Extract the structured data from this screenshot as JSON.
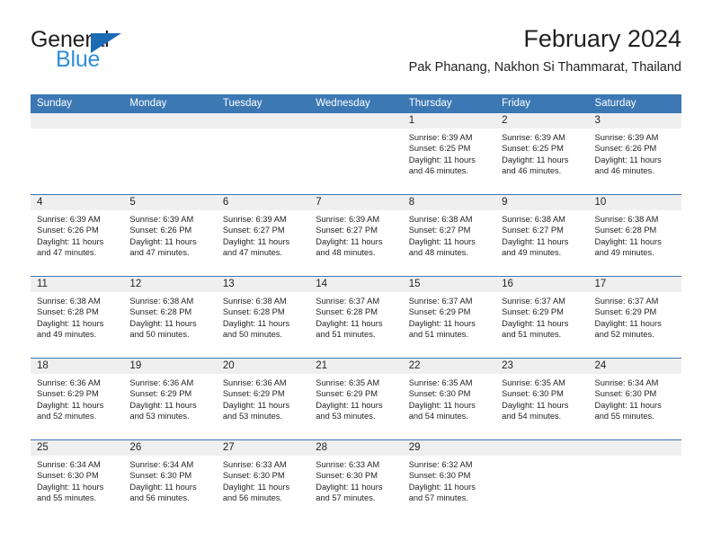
{
  "brand": {
    "name_top": "General",
    "name_bottom": "Blue",
    "accent_color": "#2f8fd6",
    "triangle_color": "#1b6cb5"
  },
  "header": {
    "title": "February 2024",
    "subtitle": "Pak Phanang, Nakhon Si Thammarat, Thailand"
  },
  "calendar": {
    "header_bg": "#3c78b4",
    "header_text_color": "#ffffff",
    "day_band_bg": "#efefef",
    "weekdays": [
      "Sunday",
      "Monday",
      "Tuesday",
      "Wednesday",
      "Thursday",
      "Friday",
      "Saturday"
    ],
    "weeks": [
      [
        {
          "day": "",
          "sunrise": "",
          "sunset": "",
          "daylight": ""
        },
        {
          "day": "",
          "sunrise": "",
          "sunset": "",
          "daylight": ""
        },
        {
          "day": "",
          "sunrise": "",
          "sunset": "",
          "daylight": ""
        },
        {
          "day": "",
          "sunrise": "",
          "sunset": "",
          "daylight": ""
        },
        {
          "day": "1",
          "sunrise": "Sunrise: 6:39 AM",
          "sunset": "Sunset: 6:25 PM",
          "daylight": "Daylight: 11 hours and 46 minutes."
        },
        {
          "day": "2",
          "sunrise": "Sunrise: 6:39 AM",
          "sunset": "Sunset: 6:25 PM",
          "daylight": "Daylight: 11 hours and 46 minutes."
        },
        {
          "day": "3",
          "sunrise": "Sunrise: 6:39 AM",
          "sunset": "Sunset: 6:26 PM",
          "daylight": "Daylight: 11 hours and 46 minutes."
        }
      ],
      [
        {
          "day": "4",
          "sunrise": "Sunrise: 6:39 AM",
          "sunset": "Sunset: 6:26 PM",
          "daylight": "Daylight: 11 hours and 47 minutes."
        },
        {
          "day": "5",
          "sunrise": "Sunrise: 6:39 AM",
          "sunset": "Sunset: 6:26 PM",
          "daylight": "Daylight: 11 hours and 47 minutes."
        },
        {
          "day": "6",
          "sunrise": "Sunrise: 6:39 AM",
          "sunset": "Sunset: 6:27 PM",
          "daylight": "Daylight: 11 hours and 47 minutes."
        },
        {
          "day": "7",
          "sunrise": "Sunrise: 6:39 AM",
          "sunset": "Sunset: 6:27 PM",
          "daylight": "Daylight: 11 hours and 48 minutes."
        },
        {
          "day": "8",
          "sunrise": "Sunrise: 6:38 AM",
          "sunset": "Sunset: 6:27 PM",
          "daylight": "Daylight: 11 hours and 48 minutes."
        },
        {
          "day": "9",
          "sunrise": "Sunrise: 6:38 AM",
          "sunset": "Sunset: 6:27 PM",
          "daylight": "Daylight: 11 hours and 49 minutes."
        },
        {
          "day": "10",
          "sunrise": "Sunrise: 6:38 AM",
          "sunset": "Sunset: 6:28 PM",
          "daylight": "Daylight: 11 hours and 49 minutes."
        }
      ],
      [
        {
          "day": "11",
          "sunrise": "Sunrise: 6:38 AM",
          "sunset": "Sunset: 6:28 PM",
          "daylight": "Daylight: 11 hours and 49 minutes."
        },
        {
          "day": "12",
          "sunrise": "Sunrise: 6:38 AM",
          "sunset": "Sunset: 6:28 PM",
          "daylight": "Daylight: 11 hours and 50 minutes."
        },
        {
          "day": "13",
          "sunrise": "Sunrise: 6:38 AM",
          "sunset": "Sunset: 6:28 PM",
          "daylight": "Daylight: 11 hours and 50 minutes."
        },
        {
          "day": "14",
          "sunrise": "Sunrise: 6:37 AM",
          "sunset": "Sunset: 6:28 PM",
          "daylight": "Daylight: 11 hours and 51 minutes."
        },
        {
          "day": "15",
          "sunrise": "Sunrise: 6:37 AM",
          "sunset": "Sunset: 6:29 PM",
          "daylight": "Daylight: 11 hours and 51 minutes."
        },
        {
          "day": "16",
          "sunrise": "Sunrise: 6:37 AM",
          "sunset": "Sunset: 6:29 PM",
          "daylight": "Daylight: 11 hours and 51 minutes."
        },
        {
          "day": "17",
          "sunrise": "Sunrise: 6:37 AM",
          "sunset": "Sunset: 6:29 PM",
          "daylight": "Daylight: 11 hours and 52 minutes."
        }
      ],
      [
        {
          "day": "18",
          "sunrise": "Sunrise: 6:36 AM",
          "sunset": "Sunset: 6:29 PM",
          "daylight": "Daylight: 11 hours and 52 minutes."
        },
        {
          "day": "19",
          "sunrise": "Sunrise: 6:36 AM",
          "sunset": "Sunset: 6:29 PM",
          "daylight": "Daylight: 11 hours and 53 minutes."
        },
        {
          "day": "20",
          "sunrise": "Sunrise: 6:36 AM",
          "sunset": "Sunset: 6:29 PM",
          "daylight": "Daylight: 11 hours and 53 minutes."
        },
        {
          "day": "21",
          "sunrise": "Sunrise: 6:35 AM",
          "sunset": "Sunset: 6:29 PM",
          "daylight": "Daylight: 11 hours and 53 minutes."
        },
        {
          "day": "22",
          "sunrise": "Sunrise: 6:35 AM",
          "sunset": "Sunset: 6:30 PM",
          "daylight": "Daylight: 11 hours and 54 minutes."
        },
        {
          "day": "23",
          "sunrise": "Sunrise: 6:35 AM",
          "sunset": "Sunset: 6:30 PM",
          "daylight": "Daylight: 11 hours and 54 minutes."
        },
        {
          "day": "24",
          "sunrise": "Sunrise: 6:34 AM",
          "sunset": "Sunset: 6:30 PM",
          "daylight": "Daylight: 11 hours and 55 minutes."
        }
      ],
      [
        {
          "day": "25",
          "sunrise": "Sunrise: 6:34 AM",
          "sunset": "Sunset: 6:30 PM",
          "daylight": "Daylight: 11 hours and 55 minutes."
        },
        {
          "day": "26",
          "sunrise": "Sunrise: 6:34 AM",
          "sunset": "Sunset: 6:30 PM",
          "daylight": "Daylight: 11 hours and 56 minutes."
        },
        {
          "day": "27",
          "sunrise": "Sunrise: 6:33 AM",
          "sunset": "Sunset: 6:30 PM",
          "daylight": "Daylight: 11 hours and 56 minutes."
        },
        {
          "day": "28",
          "sunrise": "Sunrise: 6:33 AM",
          "sunset": "Sunset: 6:30 PM",
          "daylight": "Daylight: 11 hours and 57 minutes."
        },
        {
          "day": "29",
          "sunrise": "Sunrise: 6:32 AM",
          "sunset": "Sunset: 6:30 PM",
          "daylight": "Daylight: 11 hours and 57 minutes."
        },
        {
          "day": "",
          "sunrise": "",
          "sunset": "",
          "daylight": ""
        },
        {
          "day": "",
          "sunrise": "",
          "sunset": "",
          "daylight": ""
        }
      ]
    ]
  }
}
